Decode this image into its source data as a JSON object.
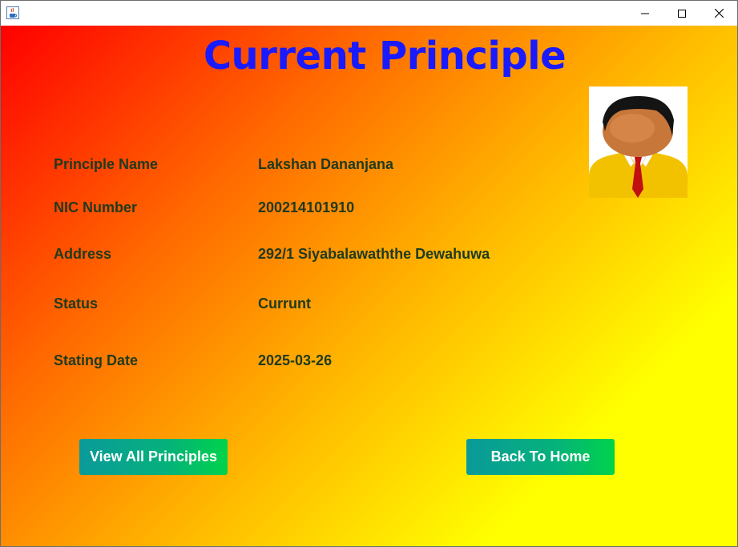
{
  "window": {
    "icon": "java-cup-icon",
    "controls": [
      "minimize-icon",
      "maximize-icon",
      "close-icon"
    ]
  },
  "page": {
    "title": "Current Principle"
  },
  "fields": [
    {
      "label": "Principle Name",
      "value": "Lakshan Dananjana"
    },
    {
      "label": "NIC Number",
      "value": "200214101910"
    },
    {
      "label": "Address",
      "value": "292/1 Siyabalawaththe Dewahuwa"
    },
    {
      "label": "Status",
      "value": "Currunt"
    },
    {
      "label": "Stating Date",
      "value": "2025-03-26"
    }
  ],
  "buttons": {
    "view_all": "View All Principles",
    "back_home": "Back To Home"
  },
  "colors": {
    "title": "#1a1aff",
    "text": "#1f3a1f",
    "gradient_start": "#ff0000",
    "gradient_end": "#ffff00",
    "button_start": "#0a9a9a",
    "button_end": "#00d34a"
  }
}
